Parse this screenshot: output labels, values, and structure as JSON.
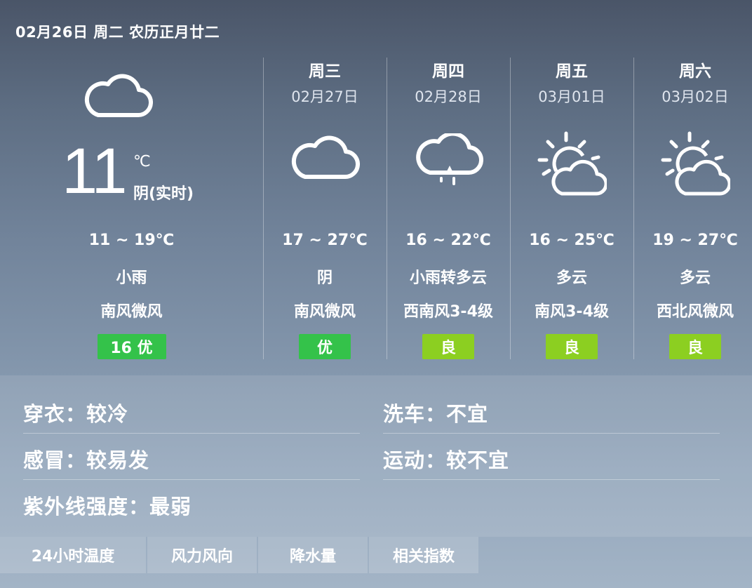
{
  "header": {
    "date_line": "02月26日 周二 农历正月廿二"
  },
  "today": {
    "icon": "cloud-icon",
    "temp": "11",
    "unit": "℃",
    "condition": "阴(实时)",
    "range": "11 ~ 19℃",
    "weather": "小雨",
    "wind": "南风微风",
    "aqi": "16 优",
    "aqi_color": "#34c24a"
  },
  "forecast": [
    {
      "day": "周三",
      "date": "02月27日",
      "icon": "cloud-icon",
      "range": "17 ~ 27℃",
      "weather": "阴",
      "wind": "南风微风",
      "aqi": "优",
      "aqi_color": "#34c24a"
    },
    {
      "day": "周四",
      "date": "02月28日",
      "icon": "rain-cloud-icon",
      "range": "16 ~ 22℃",
      "weather": "小雨转多云",
      "wind": "西南风3-4级",
      "aqi": "良",
      "aqi_color": "#8ccf21"
    },
    {
      "day": "周五",
      "date": "03月01日",
      "icon": "partly-cloudy-icon",
      "range": "16 ~ 25℃",
      "weather": "多云",
      "wind": "南风3-4级",
      "aqi": "良",
      "aqi_color": "#8ccf21"
    },
    {
      "day": "周六",
      "date": "03月02日",
      "icon": "partly-cloudy-icon",
      "range": "19 ~ 27℃",
      "weather": "多云",
      "wind": "西北风微风",
      "aqi": "良",
      "aqi_color": "#8ccf21"
    }
  ],
  "indices": {
    "clothing": "穿衣：较冷",
    "car_wash": "洗车：不宜",
    "cold": "感冒：较易发",
    "sport": "运动：较不宜",
    "uv": "紫外线强度：最弱"
  },
  "tabs": [
    "24小时温度",
    "风力风向",
    "降水量",
    "相关指数"
  ]
}
